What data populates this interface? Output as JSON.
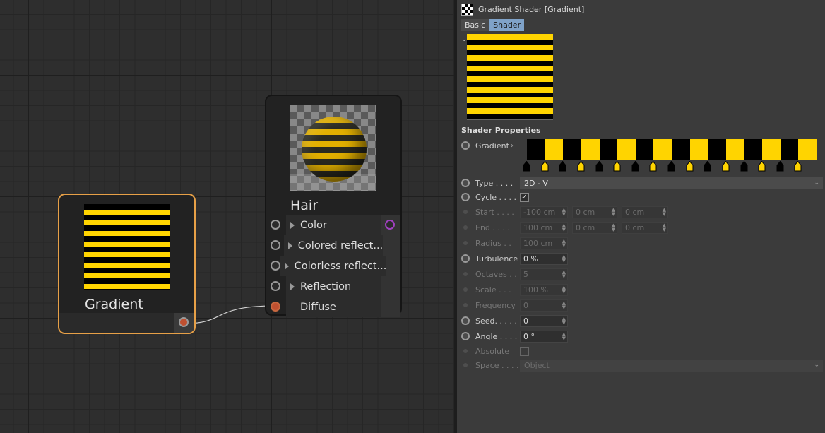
{
  "nodes": {
    "gradient": {
      "title": "Gradient"
    },
    "hair": {
      "title": "Hair",
      "ports": [
        {
          "label": "Color",
          "expandable": true
        },
        {
          "label": "Colored reflect...",
          "expandable": true
        },
        {
          "label": "Colorless reflect...",
          "expandable": true
        },
        {
          "label": "Reflection",
          "expandable": true
        },
        {
          "label": "Diffuse",
          "expandable": false
        }
      ]
    }
  },
  "panel": {
    "title": "Gradient Shader [Gradient]",
    "tabs": [
      "Basic",
      "Shader"
    ],
    "active_tab": "Shader",
    "section": "Shader Properties",
    "gradient_label": "Gradient",
    "gradient_colors": [
      "#000000",
      "#ffd400",
      "#000000",
      "#ffd400",
      "#000000",
      "#ffd400",
      "#000000",
      "#ffd400",
      "#000000",
      "#ffd400",
      "#000000",
      "#ffd400",
      "#000000",
      "#ffd400",
      "#000000",
      "#ffd400"
    ],
    "props": {
      "type": {
        "label": "Type . . . .",
        "value": "2D - V"
      },
      "cycle": {
        "label": "Cycle . . . .",
        "checked": true
      },
      "start": {
        "label": "Start . . . .",
        "values": [
          "-100 cm",
          "0 cm",
          "0 cm"
        ]
      },
      "end": {
        "label": "End  . . . .",
        "values": [
          "100 cm",
          "0 cm",
          "0 cm"
        ]
      },
      "radius": {
        "label": "Radius  . .",
        "value": "100 cm"
      },
      "turbulence": {
        "label": "Turbulence",
        "value": "0 %"
      },
      "octaves": {
        "label": "Octaves  . .",
        "value": "5"
      },
      "scale": {
        "label": "Scale  . . .",
        "value": "100 %"
      },
      "frequency": {
        "label": "Frequency",
        "value": "0"
      },
      "seed": {
        "label": "Seed. . . . .",
        "value": "0"
      },
      "angle": {
        "label": "Angle . . . .",
        "value": "0 °"
      },
      "absolute": {
        "label": "Absolute",
        "checked": false
      },
      "space": {
        "label": "Space . . . .",
        "value": "Object"
      }
    }
  }
}
